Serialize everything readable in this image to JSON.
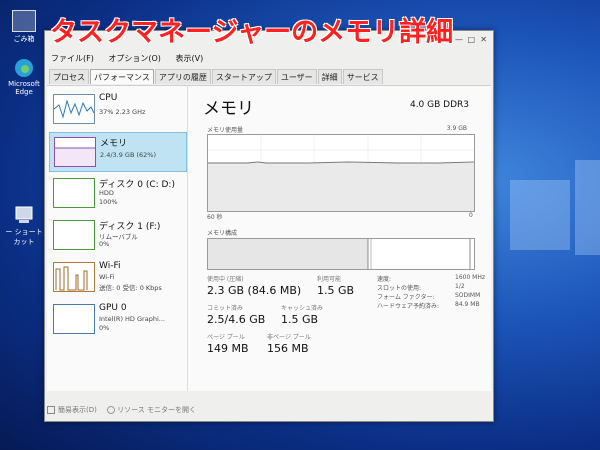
{
  "overlay": {
    "caption": "タスクマネージャーのメモリ詳細"
  },
  "desktop": {
    "shortcut_label": "ー ショートカット",
    "edge_label": "Microsoft Edge",
    "recycle_label": "ごみ箱"
  },
  "menu": [
    "ファイル(F)",
    "オプション(O)",
    "表示(V)"
  ],
  "tabs": [
    "プロセス",
    "パフォーマンス",
    "アプリの履歴",
    "スタートアップ",
    "ユーザー",
    "詳細",
    "サービス"
  ],
  "resources": [
    {
      "name": "CPU",
      "detail": "37%  2.23 GHz"
    },
    {
      "name": "メモリ",
      "detail": "2.4/3.9 GB (62%)"
    },
    {
      "name": "ディスク 0 (C: D:)",
      "detail": "HDD",
      "detail2": "100%"
    },
    {
      "name": "ディスク 1 (F:)",
      "detail": "リムーバブル",
      "detail2": "0%"
    },
    {
      "name": "Wi-Fi",
      "detail": "Wi-Fi",
      "detail2": "送信: 0  受信: 0 Kbps"
    },
    {
      "name": "GPU 0",
      "detail": "Intel(R) HD Graphi...",
      "detail2": "0%"
    }
  ],
  "memory": {
    "title": "メモリ",
    "spec": "4.0 GB DDR3",
    "usage_label": "メモリ使用量",
    "usage_max": "3.9 GB",
    "time_left": "60 秒",
    "time_right": "0",
    "composition_label": "メモリ構成",
    "stats": {
      "in_use_label": "使用中 (圧縮)",
      "in_use_value": "2.3 GB (84.6 MB)",
      "available_label": "利用可能",
      "available_value": "1.5 GB",
      "committed_label": "コミット済み",
      "committed_value": "2.5/4.6 GB",
      "cached_label": "キャッシュ済み",
      "cached_value": "1.5 GB",
      "paged_label": "ページ プール",
      "paged_value": "149 MB",
      "nonpaged_label": "非ページ プール",
      "nonpaged_value": "156 MB"
    },
    "specs": [
      {
        "k": "速度:",
        "v": "1600 MHz"
      },
      {
        "k": "スロットの使用:",
        "v": "1/2"
      },
      {
        "k": "フォーム ファクター:",
        "v": "SODIMM"
      },
      {
        "k": "ハードウェア予約済み:",
        "v": "84.9 MB"
      }
    ]
  },
  "footer": {
    "brief": "簡易表示(D)",
    "resmon": "リソース モニターを開く"
  }
}
